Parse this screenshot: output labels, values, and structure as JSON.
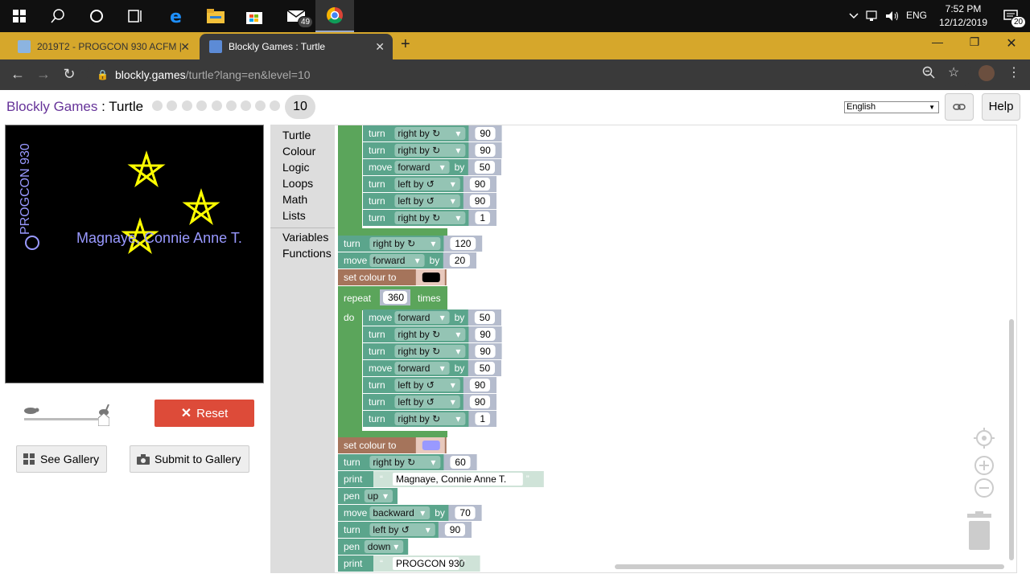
{
  "taskbar": {
    "mail_badge": "49",
    "lang": "ENG",
    "time": "7:52 PM",
    "date": "12/12/2019",
    "notif_badge": "20"
  },
  "tabs": [
    {
      "label": "2019T2 - PROGCON 930 ACFM |",
      "active": false
    },
    {
      "label": "Blockly Games : Turtle",
      "active": true
    }
  ],
  "address": {
    "host": "blockly.games",
    "path": "/turtle?lang=en&level=10"
  },
  "header": {
    "app_link": "Blockly Games",
    "separator": ":",
    "page": "Turtle",
    "level": "10",
    "language": "English",
    "help": "Help"
  },
  "canvas_text": {
    "name": "Magnaye, Connie Anne T.",
    "vertical": "PROGCON 930",
    "colors": {
      "background": "#000000",
      "star": "#ffff00",
      "moon": "#ffffff",
      "text": "#9999ff"
    }
  },
  "controls": {
    "reset": "Reset",
    "see_gallery": "See Gallery",
    "submit_gallery": "Submit to Gallery"
  },
  "toolbox": [
    "Turtle",
    "Colour",
    "Logic",
    "Loops",
    "Math",
    "Lists",
    "Variables",
    "Functions"
  ],
  "blocks": {
    "turn": "turn",
    "move": "move",
    "right_by": "right by ↻",
    "left_by": "left by ↺",
    "forward": "forward",
    "backward": "backward",
    "by": "by",
    "set_colour": "set colour to",
    "repeat": "repeat",
    "times": "times",
    "do": "do",
    "print": "print",
    "pen": "pen",
    "up": "up",
    "down": "down",
    "repeat_count": "360",
    "print_name": "Magnaye, Connie Anne T.",
    "print_progcon": "PROGCON 930",
    "colors": {
      "turtle": "#5ba58c",
      "loop": "#5ba55b",
      "colour": "#a5745b",
      "black": "#000000",
      "lilac": "#9999ff"
    }
  }
}
